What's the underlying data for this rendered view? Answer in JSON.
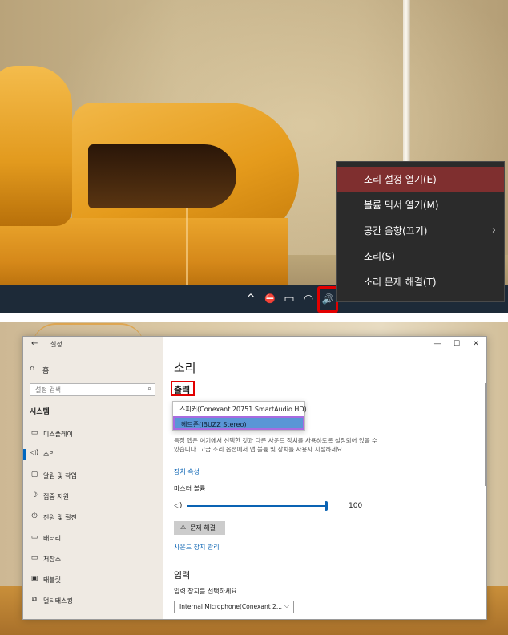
{
  "context_menu": {
    "items": [
      {
        "label": "소리 설정 열기(E)",
        "has_submenu": false,
        "active": true
      },
      {
        "label": "볼륨 믹서 열기(M)",
        "has_submenu": false,
        "active": false
      },
      {
        "label": "공간 음향(끄기)",
        "has_submenu": true,
        "active": false
      },
      {
        "label": "소리(S)",
        "has_submenu": false,
        "active": false
      },
      {
        "label": "소리 문제 해결(T)",
        "has_submenu": false,
        "active": false
      }
    ],
    "submenu_arrow": "›"
  },
  "taskbar": {
    "tray_icons": [
      "chevron-up-icon",
      "network-off-icon",
      "battery-icon",
      "wifi-icon",
      "speaker-icon"
    ],
    "tray_glyphs": [
      "^",
      "⛔",
      "▭",
      "◠",
      "🔊"
    ]
  },
  "settings": {
    "window_title": "설정",
    "back_glyph": "←",
    "controls": {
      "minimize": "—",
      "maximize": "☐",
      "close": "✕"
    },
    "sidebar": {
      "home_label": "홈",
      "search_placeholder": "설정 검색",
      "section_title": "시스템",
      "items": [
        {
          "label": "디스플레이",
          "icon": "monitor-icon",
          "glyph": "▭",
          "selected": false
        },
        {
          "label": "소리",
          "icon": "speaker-icon",
          "glyph": "◁)",
          "selected": true
        },
        {
          "label": "알림 및 작업",
          "icon": "notification-icon",
          "glyph": "▢",
          "selected": false
        },
        {
          "label": "집중 지원",
          "icon": "moon-icon",
          "glyph": "☽",
          "selected": false
        },
        {
          "label": "전원 및 절전",
          "icon": "power-icon",
          "glyph": "⏻",
          "selected": false
        },
        {
          "label": "배터리",
          "icon": "battery-icon",
          "glyph": "▭",
          "selected": false
        },
        {
          "label": "저장소",
          "icon": "storage-icon",
          "glyph": "▭",
          "selected": false
        },
        {
          "label": "태블릿",
          "icon": "tablet-icon",
          "glyph": "▣",
          "selected": false
        },
        {
          "label": "멀티태스킹",
          "icon": "multitask-icon",
          "glyph": "⧉",
          "selected": false
        }
      ]
    },
    "main": {
      "title": "소리",
      "output_heading": "출력",
      "output_devices": [
        {
          "label": "스피커(Conexant 20751 SmartAudio HD)",
          "selected": false
        },
        {
          "label": "헤드폰(IBUZZ Stereo)",
          "selected": true
        }
      ],
      "description": "특정 앱은 여기에서 선택한 것과 다른 사운드 장치를 사용하도록 설정되어 있을 수 있습니다. 고급 소리 옵션에서 앱 볼륨 및 장치를 사용자 지정하세요.",
      "device_properties_link": "장치 속성",
      "master_volume_label": "마스터 볼륨",
      "volume": 100,
      "volume_text": "100",
      "troubleshoot_label": "문제 해결",
      "manage_devices_link": "사운드 장치 관리",
      "input_heading": "입력",
      "input_select_label": "입력 장치를 선택하세요.",
      "input_device_value": "Internal Microphone(Conexant 2...",
      "chevron": "⌵"
    }
  },
  "colors": {
    "menu_bg": "#2b2b2b",
    "menu_active": "#7f2f2f",
    "highlight_red": "#e20000",
    "accent_blue": "#0a63b3",
    "taskbar_bg": "#1d2a38"
  }
}
